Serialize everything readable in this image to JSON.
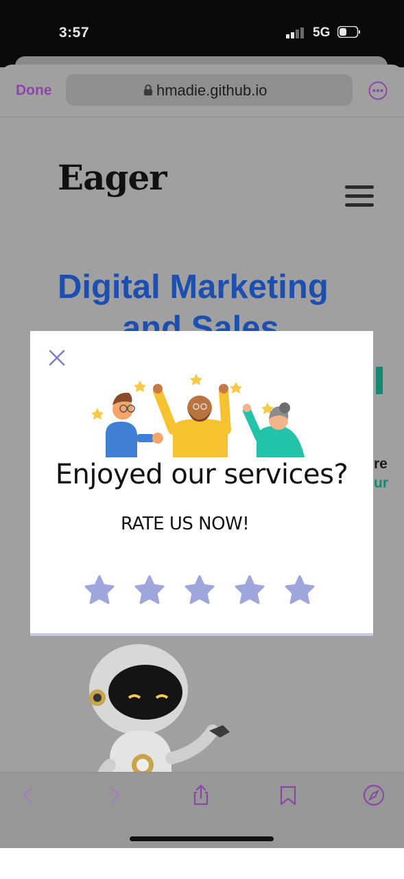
{
  "status_bar": {
    "time": "3:57",
    "network": "5G"
  },
  "browser": {
    "done_label": "Done",
    "url": "hmadie.github.io"
  },
  "page": {
    "logo": "Eager",
    "hero_line1": "Digital Marketing",
    "hero_line2": "and Sales",
    "edge_text1": "re",
    "edge_text2": "ur"
  },
  "modal": {
    "title": "Enjoyed our services?",
    "subtitle": "RATE US NOW!",
    "rating_max": 5,
    "rating_value": 0
  },
  "colors": {
    "accent_purple": "#8a47a8",
    "hero_blue": "#1c4fb0",
    "teal": "#138a73",
    "star": "#9ea6dc"
  },
  "icons": {
    "close": "close-icon",
    "star": "star-icon",
    "back": "chevron-left-icon",
    "forward": "chevron-right-icon",
    "share": "share-icon",
    "bookmarks": "bookmark-icon",
    "safari": "compass-icon"
  }
}
